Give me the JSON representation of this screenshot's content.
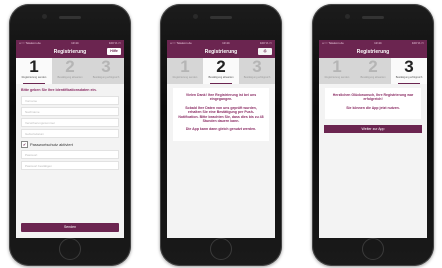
{
  "statusbar": {
    "carrier": "••○○ Telekom.de",
    "time": "13:44",
    "battery": "100 % ▭"
  },
  "screen1": {
    "title": "Registrierung",
    "nav_button": "Hilfe",
    "steps": [
      {
        "num": "1",
        "label": "Registrierung senden"
      },
      {
        "num": "2",
        "label": "Bestätigung abwarten"
      },
      {
        "num": "3",
        "label": "Bestätigung erfolgreich"
      }
    ],
    "intro": "Bitte geben Sie Ihre Identifikationsdaten ein.",
    "fields": [
      "Vorname",
      "Nachname",
      "Versicherungsnummer",
      "Geburtsdatum"
    ],
    "checkbox_label": "Passwortschutz aktiviert",
    "password_fields": [
      "Passwort",
      "Passwort bestätigen"
    ],
    "submit_label": "Senden"
  },
  "screen2": {
    "title": "Registrierung",
    "nav_button": "⎙",
    "steps": [
      {
        "num": "1",
        "label": "Registrierung senden"
      },
      {
        "num": "2",
        "label": "Bestätigung abwarten"
      },
      {
        "num": "3",
        "label": "Bestätigung erfolgreich"
      }
    ],
    "paragraphs": [
      "Vielen Dank! Ihre Registrierung ist bei uns eingegangen.",
      "Sobald Ihre Daten von uns geprüft wurden, erhalten Sie eine Bestätigung per Push-Notification. Bitte beachten Sie, dass dies bis zu 48 Stunden dauern kann.",
      "Die App kann dann gleich genutzt werden."
    ]
  },
  "screen3": {
    "title": "Registrierung",
    "steps": [
      {
        "num": "1",
        "label": "Registrierung senden"
      },
      {
        "num": "2",
        "label": "Bestätigung abwarten"
      },
      {
        "num": "3",
        "label": "Bestätigung erfolgreich"
      }
    ],
    "paragraphs": [
      "Herzlichen Glückwunsch, Ihre Registrierung war erfolgreich!",
      "Sie können die App jetzt nutzen."
    ],
    "button_label": "Weiter zur App"
  },
  "colors": {
    "brand": "#6b2550",
    "accent_text": "#8b2c64"
  }
}
